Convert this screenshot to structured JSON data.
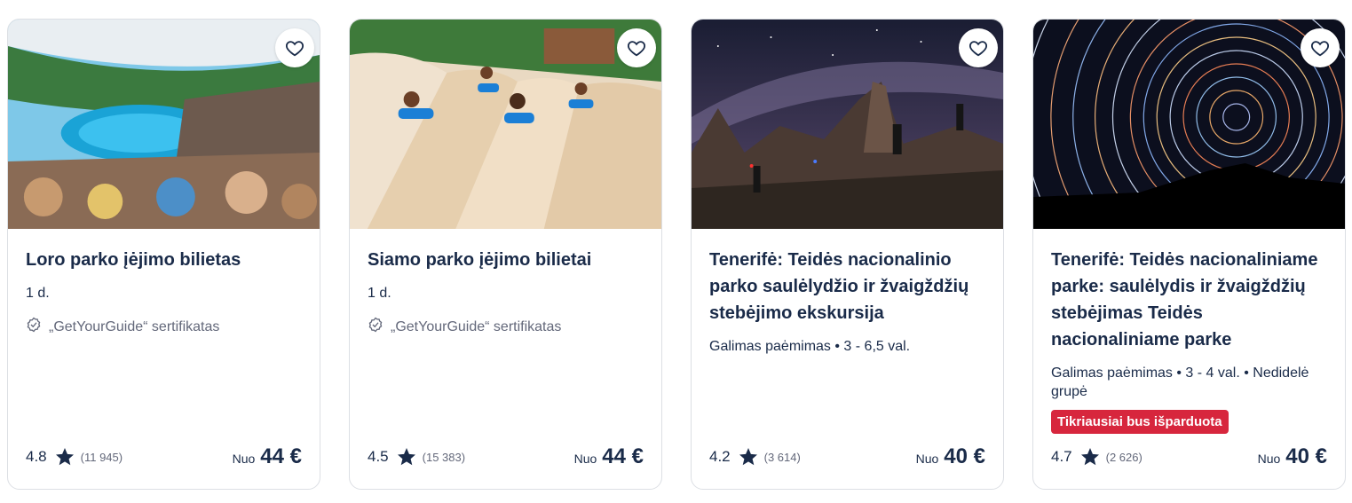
{
  "cards": [
    {
      "title": "Loro parko įėjimo bilietas",
      "meta": "1 d.",
      "certificate": "„GetYourGuide“ sertifikatas",
      "rating": "4.8",
      "reviews": "(11 945)",
      "price_prefix": "Nuo",
      "price": "44 €",
      "image": "dolphin-show-photo"
    },
    {
      "title": "Siamo parko įėjimo bilietai",
      "meta": "1 d.",
      "certificate": "„GetYourGuide“ sertifikatas",
      "rating": "4.5",
      "reviews": "(15 383)",
      "price_prefix": "Nuo",
      "price": "44 €",
      "image": "water-slide-photo"
    },
    {
      "title": "Tenerifė: Teidės nacionalinio parko saulėlydžio ir žvaigždžių stebėjimo ekskursija",
      "meta": "Galimas paėmimas • 3 - 6,5 val.",
      "rating": "4.2",
      "reviews": "(3 614)",
      "price_prefix": "Nuo",
      "price": "40 €",
      "image": "milky-way-photo"
    },
    {
      "title": "Tenerifė: Teidės nacionaliniame parke: saulėlydis ir žvaigždžių stebėjimas Teidės nacionaliniame parke",
      "meta": "Galimas paėmimas • 3 - 4 val. • Nedidelė grupė",
      "badge": "Tikriausiai bus išparduota",
      "rating": "4.7",
      "reviews": "(2 626)",
      "price_prefix": "Nuo",
      "price": "40 €",
      "image": "star-trails-photo"
    }
  ],
  "colors": {
    "text": "#1a2b49",
    "muted": "#63687a",
    "badge": "#d7263d",
    "border": "#dcdfe4"
  },
  "icons": [
    "heart-icon",
    "verified-badge-icon",
    "star-icon"
  ]
}
